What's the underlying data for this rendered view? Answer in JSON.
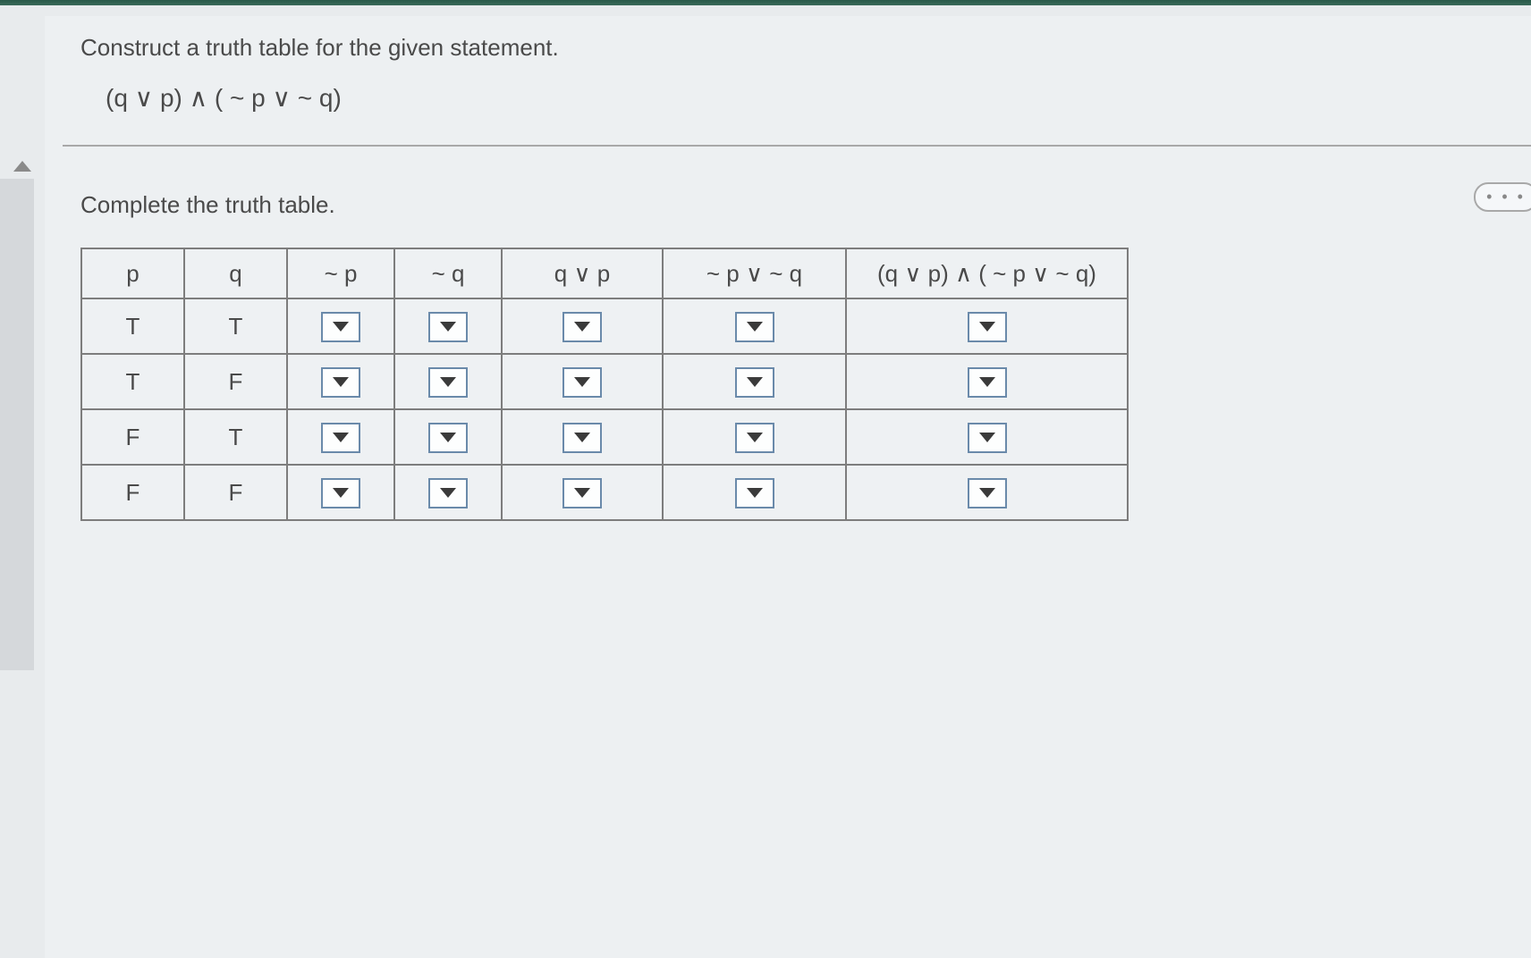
{
  "question": {
    "prompt": "Construct a truth table for the given statement.",
    "statement": "(q ∨ p) ∧ ( ~ p ∨  ~ q)",
    "instruction": "Complete the truth table."
  },
  "table": {
    "headers": [
      "p",
      "q",
      "~ p",
      "~ q",
      "q ∨ p",
      "~ p ∨ ~ q",
      "(q ∨ p) ∧ ( ~ p ∨  ~ q)"
    ],
    "rows": [
      {
        "p": "T",
        "q": "T"
      },
      {
        "p": "T",
        "q": "F"
      },
      {
        "p": "F",
        "q": "T"
      },
      {
        "p": "F",
        "q": "F"
      }
    ]
  },
  "ellipsis": "• • •"
}
